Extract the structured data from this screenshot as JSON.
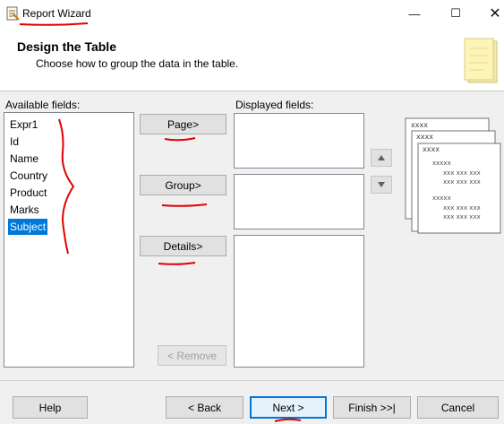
{
  "window": {
    "title": "Report Wizard",
    "minimize_symbol": "—",
    "maximize_symbol": "☐",
    "close_symbol": "✕"
  },
  "header": {
    "title": "Design the Table",
    "subtitle": "Choose how to group the data in the table."
  },
  "available": {
    "label": "Available fields:",
    "items": [
      "Expr1",
      "Id",
      "Name",
      "Country",
      "Product",
      "Marks",
      "Subject"
    ],
    "selected": "Subject"
  },
  "displayed": {
    "label": "Displayed fields:"
  },
  "buttons": {
    "page": "Page>",
    "group": "Group>",
    "details": "Details>",
    "remove": "< Remove"
  },
  "preview": {
    "header_text": "xxxx",
    "group_text": "xxxxx",
    "row_text": "xxx xxx xxx"
  },
  "footer": {
    "help": "Help",
    "back": "< Back",
    "next": "Next >",
    "finish": "Finish >>|",
    "cancel": "Cancel"
  },
  "colors": {
    "selection": "#0078d7",
    "annotation": "#e00000",
    "default_button_border": "#0078d7"
  }
}
